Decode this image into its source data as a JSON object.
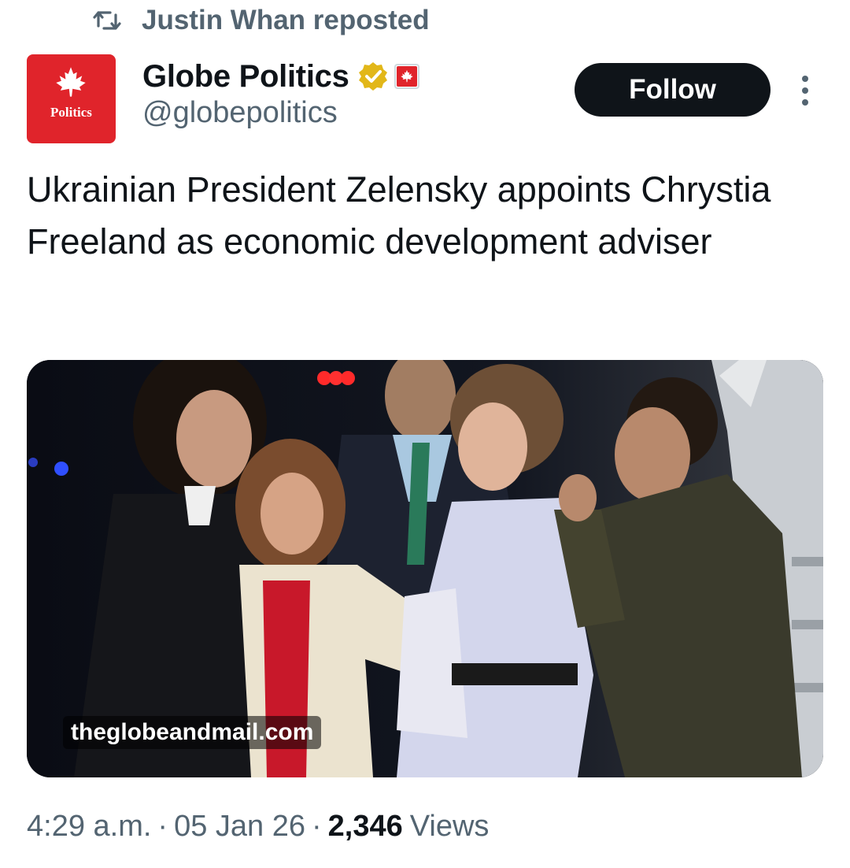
{
  "repost": {
    "icon": "repost-icon",
    "text": "Justin Whan reposted"
  },
  "author": {
    "avatar_icon": "maple-leaf-icon",
    "avatar_label": "Politics",
    "display_name": "Globe Politics",
    "verified_icon": "verified-gold-badge-icon",
    "affiliation_icon": "maple-leaf-badge-icon",
    "handle": "@globepolitics"
  },
  "actions": {
    "follow_label": "Follow",
    "more_icon": "more-vertical-icon"
  },
  "post": {
    "text": "Ukrainian President Zelensky appoints Chrystia Freeland as economic development adviser"
  },
  "card": {
    "domain": "theglobeandmail.com"
  },
  "meta": {
    "time": "4:29 a.m.",
    "separator": "·",
    "date": "05 Jan 26",
    "views_count": "2,346",
    "views_label": "Views"
  },
  "colors": {
    "brand_red": "#e0242b",
    "verified_gold": "#e2b719",
    "follow_bg": "#0f1419",
    "secondary_text": "#536471"
  }
}
